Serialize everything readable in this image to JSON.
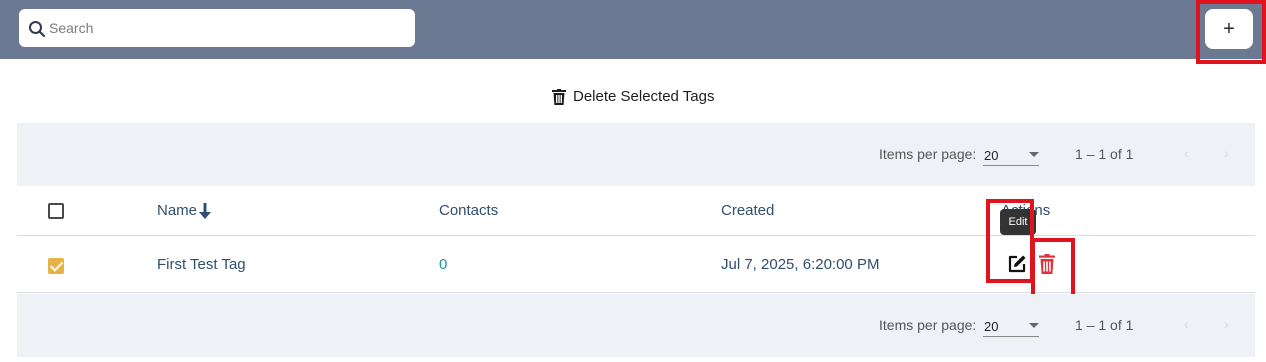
{
  "search": {
    "placeholder": "Search",
    "value": ""
  },
  "toolbar": {
    "add_label": "+"
  },
  "bulk": {
    "delete_selected_label": "Delete Selected Tags"
  },
  "pagination": {
    "items_per_page_label": "Items per page:",
    "page_size": "20",
    "range": "1 – 1 of 1"
  },
  "table": {
    "columns": {
      "name": "Name",
      "contacts": "Contacts",
      "created": "Created",
      "actions": "Actions"
    },
    "rows": [
      {
        "name": "First Test Tag",
        "contacts": "0",
        "created": "Jul 7, 2025, 6:20:00 PM",
        "selected": true
      }
    ]
  },
  "tooltip": {
    "edit": "Edit"
  },
  "colors": {
    "topbar": "#6b7a92",
    "accent": "#e5b347",
    "highlight": "#e0141e",
    "delete": "#d9363e",
    "link": "#1a9aa6"
  }
}
